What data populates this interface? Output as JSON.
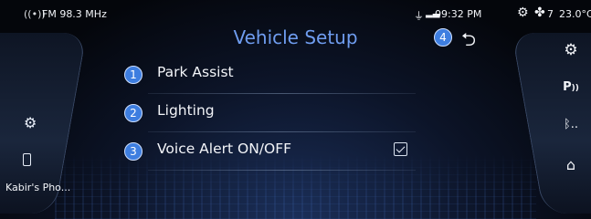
{
  "status_bar": {
    "radio_icon": "radio-signal-icon",
    "radio_text": "FM 98.3 MHz",
    "usb_icon": "usb-icon",
    "signal_icon": "signal-bars-icon",
    "time": "09:32 PM",
    "fan_speed": "7",
    "temperature": "23.0°C"
  },
  "header": {
    "title": "Vehicle Setup",
    "back_marker": "4"
  },
  "menu": {
    "items": [
      {
        "number": "1",
        "label": "Park Assist"
      },
      {
        "number": "2",
        "label": "Lighting"
      },
      {
        "number": "3",
        "label": "Voice Alert ON/OFF",
        "checked": true
      }
    ]
  },
  "left_panel": {
    "phone_label": "Kabir's Pho..."
  },
  "right_panel": {
    "icons": [
      "settings-icon",
      "park-assist-icon",
      "bluetooth-icon",
      "home-icon"
    ]
  },
  "colors": {
    "title": "#6f9df0",
    "number_badge": "#3e7ee0",
    "background": "#0c1428"
  }
}
